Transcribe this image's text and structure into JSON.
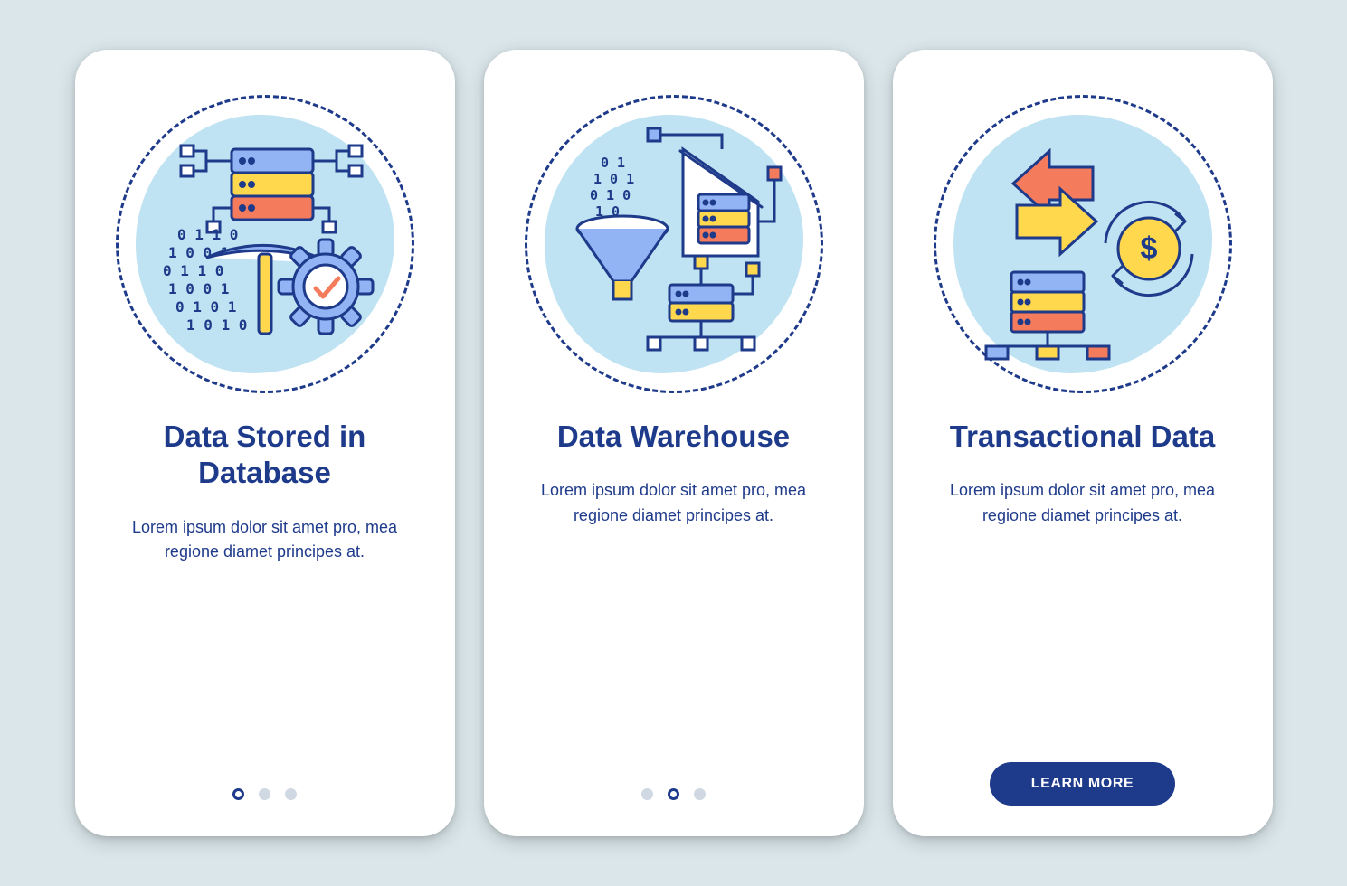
{
  "screens": [
    {
      "title": "Data Stored in Database",
      "description": "Lorem ipsum dolor sit amet pro, mea regione diamet principes at.",
      "active_dot": 0,
      "show_button": false
    },
    {
      "title": "Data Warehouse",
      "description": "Lorem ipsum dolor sit amet pro, mea regione diamet principes at.",
      "active_dot": 1,
      "show_button": false
    },
    {
      "title": "Transactional Data",
      "description": "Lorem ipsum dolor sit amet pro, mea regione diamet principes at.",
      "active_dot": 2,
      "show_button": true
    }
  ],
  "cta_label": "LEARN MORE",
  "colors": {
    "primary": "#1e3a8a",
    "bg": "#dae6ea",
    "accent_blue": "#93b4f4",
    "accent_yellow": "#ffd84d",
    "accent_orange": "#f47b5b",
    "light_blue": "#bfe3f2"
  }
}
